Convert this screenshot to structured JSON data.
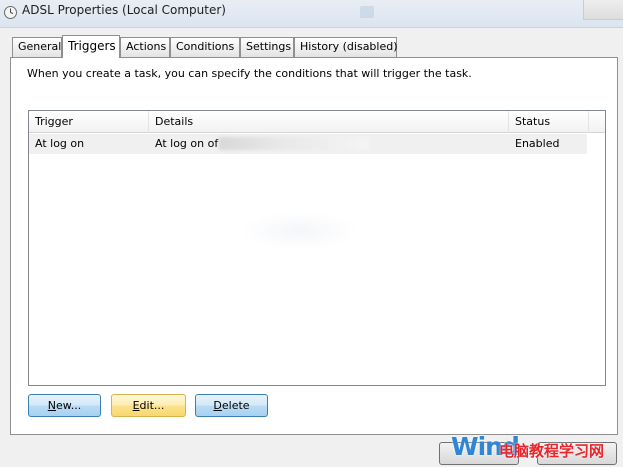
{
  "window": {
    "title": "ADSL Properties (Local Computer)",
    "icon": "clock-icon"
  },
  "tabs": [
    {
      "label": "General",
      "active": false
    },
    {
      "label": "Triggers",
      "active": true
    },
    {
      "label": "Actions",
      "active": false
    },
    {
      "label": "Conditions",
      "active": false
    },
    {
      "label": "Settings",
      "active": false
    },
    {
      "label": "History (disabled)",
      "active": false
    }
  ],
  "triggers_panel": {
    "description": "When you create a task, you can specify the conditions that will trigger the task.",
    "columns": [
      "Trigger",
      "Details",
      "Status"
    ],
    "rows": [
      {
        "trigger": "At log on",
        "details": "At log on of",
        "status": "Enabled"
      }
    ],
    "buttons": {
      "new": {
        "mnemonic": "N",
        "rest": "ew..."
      },
      "edit": {
        "mnemonic": "E",
        "rest": "dit..."
      },
      "delete": {
        "mnemonic": "D",
        "rest": "elete"
      }
    }
  },
  "watermark": {
    "latin": "Wind",
    "chinese": "电脑教程学习网"
  },
  "colors": {
    "button_blue": "#b9dcf5",
    "button_hover": "#fbe28c",
    "watermark_blue": "#2f86d6",
    "watermark_red": "#e8262c"
  }
}
